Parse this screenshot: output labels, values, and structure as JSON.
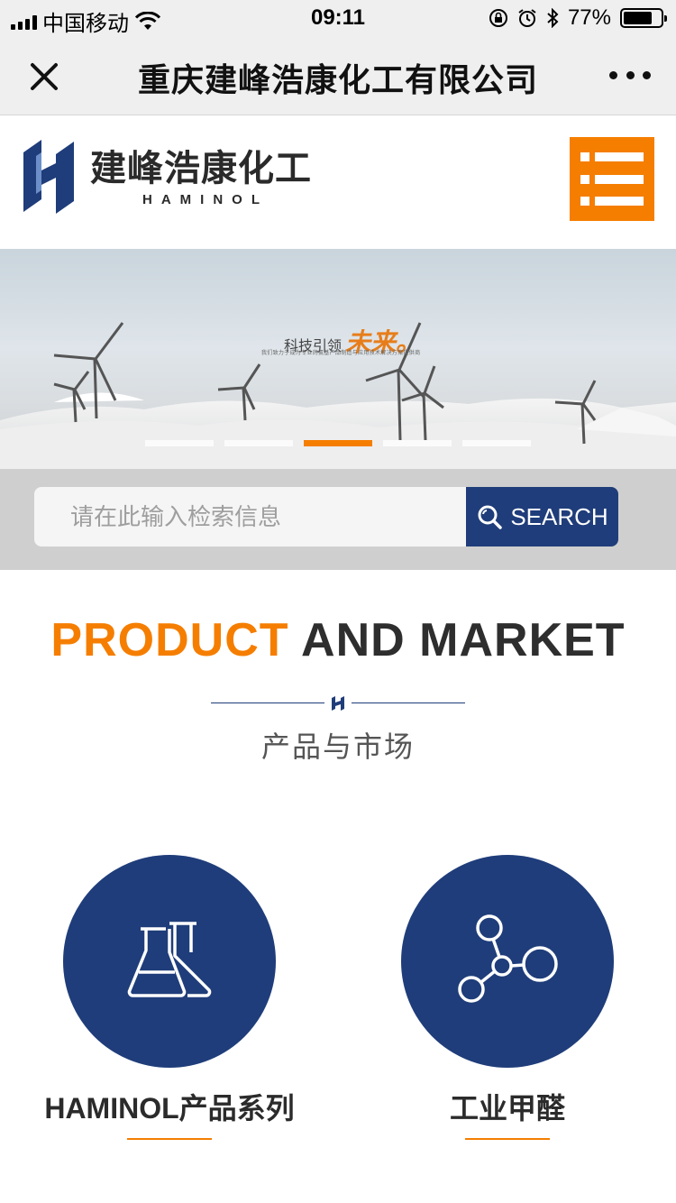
{
  "status_bar": {
    "carrier": "中国移动",
    "time": "09:11",
    "battery_percent": "77%",
    "battery_level": 0.77,
    "icons": [
      "signal-icon",
      "wifi-icon",
      "orientation-lock-icon",
      "alarm-icon",
      "bluetooth-icon",
      "battery-icon"
    ]
  },
  "nav": {
    "title": "重庆建峰浩康化工有限公司",
    "close_icon": "close-icon",
    "more_icon": "more-icon"
  },
  "header": {
    "logo_cn": "建峰浩康化工",
    "logo_en": "HAMINOL",
    "menu_icon": "menu-icon",
    "accent_color": "#f57e00",
    "brand_color": "#1f3d7a"
  },
  "banner": {
    "slogan_prefix": "科技引领",
    "slogan_highlight": "未来。",
    "slogan_sub": "我们致力于成为专业的氨基产品制造与应用技术解决方案提供商",
    "slide_count": 5,
    "active_slide": 3
  },
  "search": {
    "placeholder": "请在此输入检索信息",
    "button_label": "SEARCH"
  },
  "section": {
    "title_highlight": "PRODUCT",
    "title_rest": "AND MARKET",
    "subtitle": "产品与市场"
  },
  "categories": [
    {
      "label": "HAMINOL产品系列",
      "icon": "flask-icon"
    },
    {
      "label": "工业甲醛",
      "icon": "molecule-icon"
    }
  ]
}
